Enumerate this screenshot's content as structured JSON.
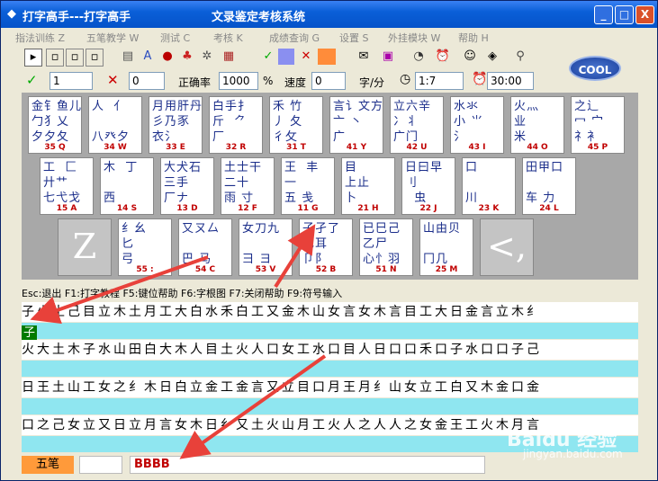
{
  "window": {
    "title_left": "打字高手---打字高手",
    "title_center": "文录鉴定考核系统",
    "min_label": "_",
    "max_label": "□",
    "close_label": "X"
  },
  "menu": [
    {
      "label": "指法训练 Z"
    },
    {
      "label": "五笔教学 W"
    },
    {
      "label": "测试 C"
    },
    {
      "label": "考核 K"
    },
    {
      "label": "成绩查询 G"
    },
    {
      "label": "设置 S"
    },
    {
      "label": "外挂模块 W"
    },
    {
      "label": "帮助 H"
    }
  ],
  "toolbar": {
    "correct_count": "1",
    "wrong_count": "0",
    "accuracy_label": "正确率",
    "accuracy_value": "1000",
    "accuracy_unit": "%",
    "speed_label": "速度",
    "speed_value": "0",
    "speed_unit": "字/分",
    "ratio_value": "1:7",
    "time_value": "30:00",
    "logo": "COOL"
  },
  "keyboard": {
    "row1": [
      {
        "roots": "金钅鱼儿\n勹犭乂\n夕夕夂",
        "code": "35 Q"
      },
      {
        "roots": "人  亻\n\n八癶夕",
        "code": "34 W"
      },
      {
        "roots": "月用肝丹\n彡乃豕\n衣氵",
        "code": "33 E"
      },
      {
        "roots": "白手扌\n斤  ⺈\n厂",
        "code": "32 R"
      },
      {
        "roots": "禾 竹\n丿 夂\n彳攵",
        "code": "31 T"
      },
      {
        "roots": "言讠文方\n亠 丶\n广",
        "code": "41 Y"
      },
      {
        "roots": "立六辛\n冫丬\n广门",
        "code": "42 U"
      },
      {
        "roots": "水氺\n小 ⺌\n氵",
        "code": "43 I"
      },
      {
        "roots": "火灬\n业 \n米",
        "code": "44 O"
      },
      {
        "roots": "之辶\n冖 宀\n礻衤",
        "code": "45 P"
      }
    ],
    "row2": [
      {
        "roots": "工  匚\n廾艹 \n七弋戈",
        "code": "15 A"
      },
      {
        "roots": "木  丁\n\n西",
        "code": "14 S"
      },
      {
        "roots": "大犬石\n三手\n厂ナ",
        "code": "13 D"
      },
      {
        "roots": "土士干\n二十\n雨 寸",
        "code": "12 F"
      },
      {
        "roots": "王  丰\n一\n五 戋",
        "code": "11 G"
      },
      {
        "roots": "目  \n上止\n卜",
        "code": "21 H"
      },
      {
        "roots": "日曰早\n刂  \n  虫",
        "code": "22 J"
      },
      {
        "roots": "口\n\n川",
        "code": "23 K"
      },
      {
        "roots": "田甲口\n\n车 力",
        "code": "24 L"
      }
    ],
    "row3_blank_left": "Z",
    "row3": [
      {
        "roots": "纟幺\n匕\n弓",
        "code": "55 :"
      },
      {
        "roots": "又ㄡ厶\n\n巴 马",
        "code": "54 C"
      },
      {
        "roots": "女刀九\n \n彐 ヨ",
        "code": "53 V"
      },
      {
        "roots": "子孑了\n也耳\n卩阝",
        "code": "52 B"
      },
      {
        "roots": "已巳己\n乙尸\n心忄羽",
        "code": "51 N"
      },
      {
        "roots": "山由贝\n\n冂几",
        "code": "25 M"
      }
    ],
    "row3_blank_right": "<,"
  },
  "help_text": "Esc:退出  F1:打字教程  F5:键位帮助  F6:字根图  F7:关闭帮助  F9:符号输入",
  "practice": {
    "lines": [
      "子火土己目立木土月工大白水禾白工又金木山女言女木言目工大日金言立木纟",
      "火大土木子水山田白大木人目土火人口女工水口目人日口口禾口子水口口子己",
      "日王土山工女之纟木日白立金工金言又立目口月王月纟山女立工白又木金口金",
      "口之己女立又日立月言女木日纟又土火山月工火人之人人之女金王工火木月言"
    ],
    "typed_chars": [
      "子"
    ]
  },
  "status": {
    "mode": "五笔",
    "input_code": "BBBB"
  },
  "watermark": {
    "main": "Baidu 经验",
    "sub": "jingyan.baidu.com"
  }
}
